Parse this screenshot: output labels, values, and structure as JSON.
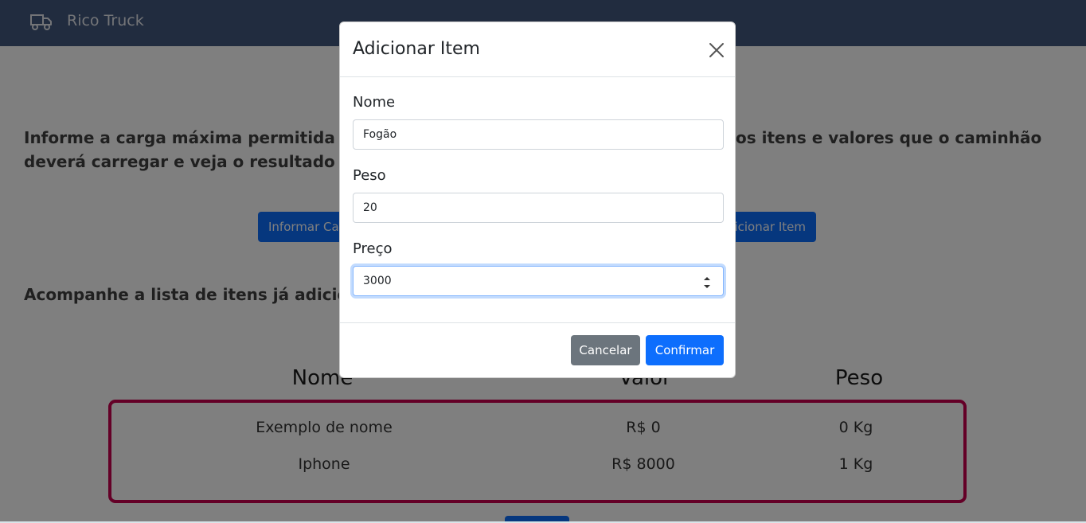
{
  "navbar": {
    "brand": "Rico Truck",
    "icon": "truck-icon"
  },
  "intro": {
    "line1": "Informe a carga máxima permitida p",
    "line1_end": "os itens e valores que o caminhão",
    "line2": "deverá carregar e veja o resultado ra"
  },
  "actions": {
    "capacity_label": "Informar Car",
    "add_item_label": "dicionar Item"
  },
  "list_heading": "Acompanhe a lista de itens já adicio",
  "table": {
    "headers": [
      "Nome",
      "Valor",
      "Peso"
    ],
    "rows": [
      [
        "Exemplo de nome",
        "R$ 0",
        "0 Kg"
      ],
      [
        "Iphone",
        "R$ 8000",
        "1 Kg"
      ]
    ]
  },
  "modal": {
    "title": "Adicionar Item",
    "fields": {
      "nome": {
        "label": "Nome",
        "value": "Fogão"
      },
      "peso": {
        "label": "Peso",
        "value": "20"
      },
      "preco": {
        "label": "Preço",
        "value": "3000"
      }
    },
    "cancel_label": "Cancelar",
    "confirm_label": "Confirmar"
  },
  "colors": {
    "navbar": "#42587f",
    "primary": "#0d6efd",
    "secondary": "#6c757d",
    "table_border": "#c8004f"
  }
}
